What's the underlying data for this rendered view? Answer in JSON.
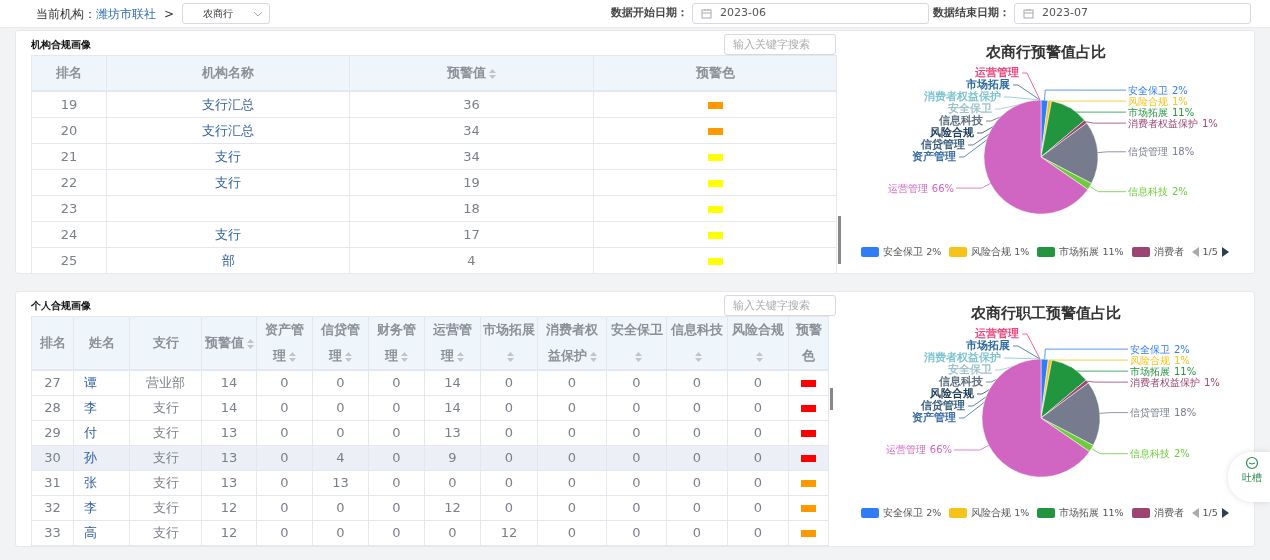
{
  "filter_bar": {
    "org_label": "当前机构：",
    "org_link": "潍坊市联社",
    "separator": ">",
    "bank_select": "农商行",
    "start_label": "数据开始日期：",
    "start_date": "2023-06",
    "end_label": "数据结束日期：",
    "end_date": "2023-07"
  },
  "org_panel": {
    "title": "机构合规画像",
    "search": {
      "placeholder": "输入关键字搜索"
    },
    "table": {
      "columns": [
        {
          "label": "排名",
          "sortable": false
        },
        {
          "label": "机构名称",
          "sortable": false
        },
        {
          "label": "预警值",
          "sortable": true
        },
        {
          "label": "预警色",
          "sortable": false
        }
      ],
      "rows": [
        {
          "cells": [
            "19",
            "支行汇总",
            "36"
          ],
          "color": "#ff9900"
        },
        {
          "cells": [
            "20",
            "支行汇总",
            "34"
          ],
          "color": "#ff9900"
        },
        {
          "cells": [
            "21",
            "支行",
            "34"
          ],
          "color": "#ffff00"
        },
        {
          "cells": [
            "22",
            "支行",
            "19"
          ],
          "color": "#ffff00"
        },
        {
          "cells": [
            "23",
            null,
            "18"
          ],
          "color": "#ffff00"
        },
        {
          "cells": [
            "24",
            "支行",
            "17"
          ],
          "color": "#ffff00"
        },
        {
          "cells": [
            "25",
            "部",
            "4"
          ],
          "color": "#ffff00"
        }
      ]
    },
    "chart": {
      "chart_data": {
        "type": "pie",
        "title": "农商行预警值占比",
        "categories": [
          "安全保卫",
          "风险合规",
          "市场拓展",
          "消费者权益保护",
          "信贷管理",
          "信息科技",
          "运营管理"
        ],
        "values": [
          2,
          1,
          11,
          1,
          18,
          2,
          66
        ],
        "value_labels": [
          "2%",
          "1%",
          "11%",
          "1%",
          "18%",
          "2%",
          "66%"
        ]
      },
      "slice_colors": [
        {
          "color": "#2f7df6"
        },
        {
          "color": "#f7c21a"
        },
        {
          "color": "#22963f"
        },
        {
          "color": "#9c4472"
        },
        {
          "color": "#767b8e"
        },
        {
          "color": "#6ecc3a"
        },
        {
          "color": "#d066c2"
        }
      ],
      "zero_labels": [
        {
          "text": "运营管理",
          "color": "#f0437a"
        },
        {
          "text": "市场拓展",
          "color": "#2a6aa0"
        },
        {
          "text": "消费者权益保护",
          "color": "#7ec4cf"
        },
        {
          "text": "安全保卫",
          "color": "#9cc3cc"
        },
        {
          "text": "信息科技",
          "color": "#5d6f80"
        },
        {
          "text": "风险合规",
          "color": "#1f3d5a"
        },
        {
          "text": "信贷管理",
          "color": "#3b5f7e"
        },
        {
          "text": "资产管理",
          "color": "#3a6ea5"
        }
      ],
      "legend": {
        "items": [
          {
            "text": "安全保卫 2%",
            "color": "#2f7df6"
          },
          {
            "text": "风险合规 1%",
            "color": "#f7c21a"
          },
          {
            "text": "市场拓展 11%",
            "color": "#22963f"
          },
          {
            "text": "消费者",
            "color": "#9c4472"
          }
        ],
        "page": "1/5"
      }
    }
  },
  "staff_panel": {
    "title": "个人合规画像",
    "search": {
      "placeholder": "输入关键字搜索"
    },
    "table": {
      "columns": [
        {
          "label": "排名",
          "sortable": false
        },
        {
          "label": "姓名",
          "sortable": false
        },
        {
          "label": "支行",
          "sortable": false
        },
        {
          "label": "预警值",
          "sortable": true
        },
        {
          "label": "资产管理",
          "sortable": true
        },
        {
          "label": "信贷管理",
          "sortable": true
        },
        {
          "label": "财务管理",
          "sortable": true
        },
        {
          "label": "运营管理",
          "sortable": true
        },
        {
          "label": "市场拓展",
          "sortable": true
        },
        {
          "label": "消费者权益保护",
          "sortable": true
        },
        {
          "label": "安全保卫",
          "sortable": true
        },
        {
          "label": "信息科技",
          "sortable": true
        },
        {
          "label": "风险合规",
          "sortable": true
        },
        {
          "label": "预警色",
          "sortable": false
        }
      ],
      "rows": [
        {
          "cells": [
            "27",
            "谭",
            "营业部",
            "14",
            "0",
            "0",
            "0",
            "14",
            "0",
            "0",
            "0",
            "0",
            "0"
          ],
          "color": "#ff0000",
          "selected": false
        },
        {
          "cells": [
            "28",
            "李",
            "支行",
            "14",
            "0",
            "0",
            "0",
            "14",
            "0",
            "0",
            "0",
            "0",
            "0"
          ],
          "color": "#ff0000",
          "selected": false
        },
        {
          "cells": [
            "29",
            "付",
            "支行",
            "13",
            "0",
            "0",
            "0",
            "13",
            "0",
            "0",
            "0",
            "0",
            "0"
          ],
          "color": "#ff0000",
          "selected": false
        },
        {
          "cells": [
            "30",
            "孙",
            "支行",
            "13",
            "0",
            "4",
            "0",
            "9",
            "0",
            "0",
            "0",
            "0",
            "0"
          ],
          "color": "#ff0000",
          "selected": true
        },
        {
          "cells": [
            "31",
            "张",
            "支行",
            "13",
            "0",
            "13",
            "0",
            "0",
            "0",
            "0",
            "0",
            "0",
            "0"
          ],
          "color": "#ff9900",
          "selected": false
        },
        {
          "cells": [
            "32",
            "李",
            "支行",
            "12",
            "0",
            "0",
            "0",
            "12",
            "0",
            "0",
            "0",
            "0",
            "0"
          ],
          "color": "#ff9900",
          "selected": false
        },
        {
          "cells": [
            "33",
            "高",
            "支行",
            "12",
            "0",
            "0",
            "0",
            "0",
            "12",
            "0",
            "0",
            "0",
            "0"
          ],
          "color": "#ff9900",
          "selected": false
        }
      ]
    },
    "chart": {
      "chart_data": {
        "type": "pie",
        "title": "农商行职工预警值占比",
        "categories": [
          "安全保卫",
          "风险合规",
          "市场拓展",
          "消费者权益保护",
          "信贷管理",
          "信息科技",
          "运营管理"
        ],
        "values": [
          2,
          1,
          11,
          1,
          18,
          2,
          66
        ],
        "value_labels": [
          "2%",
          "1%",
          "11%",
          "1%",
          "18%",
          "2%",
          "66%"
        ]
      },
      "slice_colors": [
        {
          "color": "#2f7df6"
        },
        {
          "color": "#f7c21a"
        },
        {
          "color": "#22963f"
        },
        {
          "color": "#9c4472"
        },
        {
          "color": "#767b8e"
        },
        {
          "color": "#6ecc3a"
        },
        {
          "color": "#d066c2"
        }
      ],
      "zero_labels": [
        {
          "text": "运营管理",
          "color": "#f0437a"
        },
        {
          "text": "市场拓展",
          "color": "#2a6aa0"
        },
        {
          "text": "消费者权益保护",
          "color": "#7ec4cf"
        },
        {
          "text": "安全保卫",
          "color": "#9cc3cc"
        },
        {
          "text": "信息科技",
          "color": "#5d6f80"
        },
        {
          "text": "风险合规",
          "color": "#1f3d5a"
        },
        {
          "text": "信贷管理",
          "color": "#3b5f7e"
        },
        {
          "text": "资产管理",
          "color": "#3a6ea5"
        }
      ],
      "legend": {
        "items": [
          {
            "text": "安全保卫 2%",
            "color": "#2f7df6"
          },
          {
            "text": "风险合规 1%",
            "color": "#f7c21a"
          },
          {
            "text": "市场拓展 11%",
            "color": "#22963f"
          },
          {
            "text": "消费者",
            "color": "#9c4472"
          }
        ],
        "page": "1/5"
      }
    }
  },
  "feedback": {
    "label": "吐槽"
  }
}
